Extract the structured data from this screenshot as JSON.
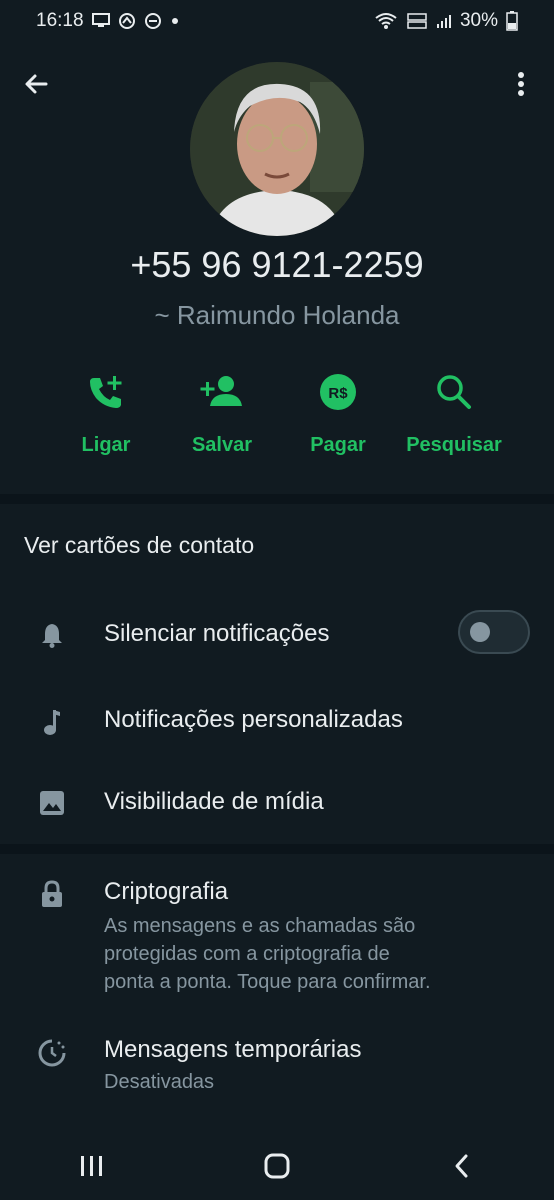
{
  "status_bar": {
    "time": "16:18",
    "battery": "30%"
  },
  "contact": {
    "phone": "+55 96 9121-2259",
    "alias": "~ Raimundo Holanda"
  },
  "actions": {
    "call": "Ligar",
    "save": "Salvar",
    "pay": "Pagar",
    "search": "Pesquisar"
  },
  "contact_cards": "Ver cartões de contato",
  "settings": {
    "mute": {
      "label": "Silenciar notificações",
      "enabled": false
    },
    "custom_notifications": "Notificações personalizadas",
    "media_visibility": "Visibilidade de mídia",
    "encryption": {
      "title": "Criptografia",
      "lines": [
        "As mensagens e as chamadas são",
        "protegidas com a criptografia de",
        "ponta a ponta. Toque para confirmar."
      ]
    },
    "disappearing": {
      "title": "Mensagens temporárias",
      "value": "Desativadas"
    }
  },
  "colors": {
    "background": "#111b21",
    "accent": "#21c063",
    "secondary_text": "#8696a0"
  },
  "icons": [
    "back-arrow-icon",
    "more-vert-icon",
    "call-add-icon",
    "person-add-icon",
    "pay-real-icon",
    "search-icon",
    "bell-icon",
    "music-note-icon",
    "image-icon",
    "lock-icon",
    "timer-icon"
  ]
}
